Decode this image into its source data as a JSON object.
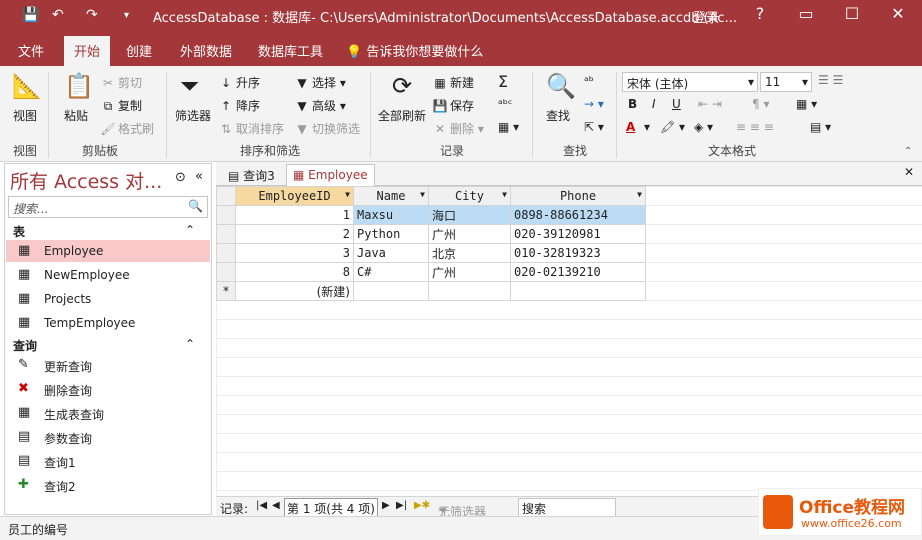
{
  "window": {
    "title": "AccessDatabase : 数据库- C:\\Users\\Administrator\\Documents\\AccessDatabase.accdb (Ac...",
    "login": "登录",
    "help": "?",
    "minimize": "─",
    "restore": "☐",
    "close": "✕"
  },
  "menu": {
    "tabs": [
      "文件",
      "开始",
      "创建",
      "外部数据",
      "数据库工具"
    ],
    "tellme": "告诉我你想要做什么"
  },
  "ribbon": {
    "view": {
      "label": "视图",
      "group": "视图"
    },
    "clipboard": {
      "paste": "粘贴",
      "cut": "剪切",
      "copy": "复制",
      "format_painter": "格式刷",
      "group": "剪贴板"
    },
    "sort_filter": {
      "filter": "筛选器",
      "asc": "升序",
      "desc": "降序",
      "remove_sort": "取消排序",
      "select": "选择",
      "advanced": "高级",
      "toggle_filter": "切换筛选",
      "group": "排序和筛选"
    },
    "records": {
      "refresh": "全部刷新",
      "new": "新建",
      "save": "保存",
      "delete": "删除",
      "group": "记录"
    },
    "find": {
      "find": "查找",
      "group": "查找"
    },
    "text_format": {
      "font": "宋体 (主体)",
      "size": "11",
      "bold": "B",
      "italic": "I",
      "underline": "U",
      "font_color": "A",
      "group": "文本格式"
    }
  },
  "nav": {
    "title": "所有 Access 对...",
    "search_placeholder": "搜索...",
    "tables_header": "表",
    "tables": [
      "Employee",
      "NewEmployee",
      "Projects",
      "TempEmployee"
    ],
    "queries_header": "查询",
    "queries": [
      "更新查询",
      "删除查询",
      "生成表查询",
      "参数查询",
      "查询1",
      "查询2"
    ]
  },
  "doc_tabs": [
    "查询3",
    "Employee"
  ],
  "table": {
    "columns": [
      "EmployeeID",
      "Name",
      "City",
      "Phone"
    ],
    "rows": [
      [
        "1",
        "Maxsu",
        "海口",
        "0898-88661234"
      ],
      [
        "2",
        "Python",
        "广州",
        "020-39120981"
      ],
      [
        "3",
        "Java",
        "北京",
        "010-32819323"
      ],
      [
        "8",
        "C#",
        "广州",
        "020-02139210"
      ]
    ],
    "new_row": "(新建)",
    "new_marker": "*"
  },
  "record_nav": {
    "label": "记录:",
    "position": "第 1 项(共 4 项)",
    "filter": "无筛选器",
    "search": "搜索"
  },
  "status": {
    "text": "员工的编号"
  },
  "watermark": {
    "brand": "Office教程网",
    "url": "www.office26.com"
  }
}
